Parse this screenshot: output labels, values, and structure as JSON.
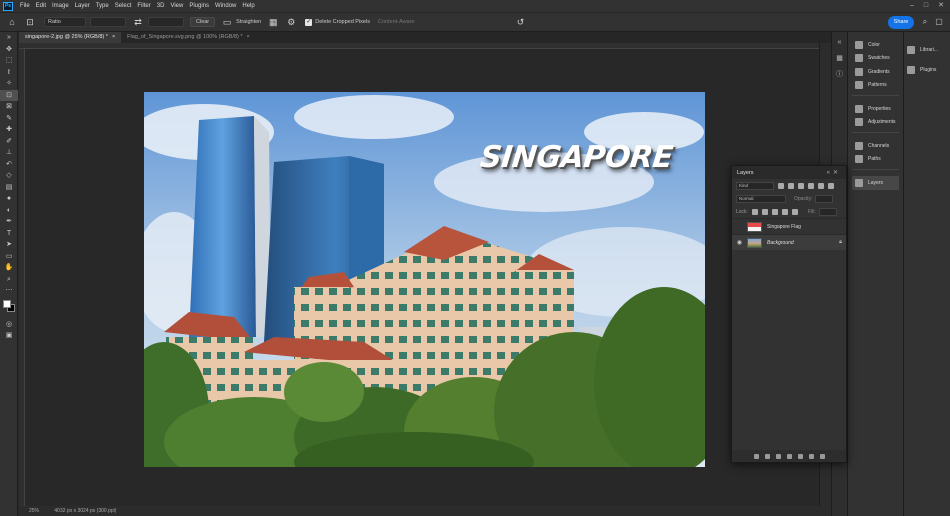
{
  "app": {
    "logo": "Ps"
  },
  "menu": [
    "File",
    "Edit",
    "Image",
    "Layer",
    "Type",
    "Select",
    "Filter",
    "3D",
    "View",
    "Plugins",
    "Window",
    "Help"
  ],
  "window_controls": [
    "–",
    "□",
    "✕"
  ],
  "options": {
    "ratio_select": "Ratio",
    "clear_label": "Clear",
    "straighten_label": "Straighten",
    "delete_cropped_label": "Delete Cropped Pixels",
    "content_aware_label": "Content-Aware",
    "share_label": "Share"
  },
  "tabs": [
    {
      "title": "singapore-2.jpg @ 25% (RGB/8) *",
      "close": "×"
    },
    {
      "title": "Flag_of_Singapore.svg.png @ 100% (RGB/8) *",
      "close": "×"
    }
  ],
  "canvas": {
    "headline": "SINGAPORE"
  },
  "status": {
    "zoom": "25%",
    "doc_size": "4032 px x 3024 px (300 ppi)"
  },
  "panels": {
    "group1": [
      "Color",
      "Swatches",
      "Gradients",
      "Patterns"
    ],
    "group2": [
      "Properties",
      "Adjustments"
    ],
    "group3": [
      "Channels",
      "Paths"
    ],
    "group4": [
      "Layers"
    ]
  },
  "far_panels": [
    "Librari...",
    "Plugins"
  ],
  "layers_panel": {
    "title": "Layers",
    "filter_select": "Kind",
    "blend_select": "Normal",
    "opacity_label": "Opacity:",
    "lock_label": "Lock:",
    "fill_label": "Fill:",
    "layers": [
      {
        "name": "Singapore Flag",
        "visible": false
      },
      {
        "name": "Background",
        "visible": true,
        "locked": true
      }
    ]
  },
  "colors": {
    "accent": "#1473e6",
    "chrome": "#323232",
    "canvas_bg": "#282828"
  }
}
